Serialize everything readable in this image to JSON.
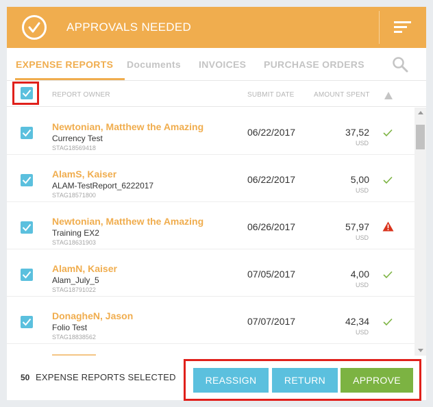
{
  "header": {
    "title": "APPROVALS NEEDED"
  },
  "tabs": [
    {
      "label": "EXPENSE REPORTS",
      "active": true
    },
    {
      "label": "Documents",
      "active": false
    },
    {
      "label": "INVOICES",
      "active": false
    },
    {
      "label": "PURCHASE ORDERS",
      "active": false
    }
  ],
  "columns": {
    "owner": "REPORT OWNER",
    "date": "SUBMIT DATE",
    "amount": "AMOUNT SPENT"
  },
  "rows": [
    {
      "owner": "Newtonian, Matthew the Amazing",
      "report": "Currency Test",
      "code": "STAG18569418",
      "date": "06/22/2017",
      "amount": "37,52",
      "currency": "USD",
      "status": "ok"
    },
    {
      "owner": "AlamS, Kaiser",
      "report": "ALAM-TestReport_6222017",
      "code": "STAG18571800",
      "date": "06/22/2017",
      "amount": "5,00",
      "currency": "USD",
      "status": "ok"
    },
    {
      "owner": "Newtonian, Matthew the Amazing",
      "report": "Training EX2",
      "code": "STAG18631903",
      "date": "06/26/2017",
      "amount": "57,97",
      "currency": "USD",
      "status": "warning"
    },
    {
      "owner": "AlamN, Kaiser",
      "report": "Alam_July_5",
      "code": "STAG18791022",
      "date": "07/05/2017",
      "amount": "4,00",
      "currency": "USD",
      "status": "ok"
    },
    {
      "owner": "DonagheN, Jason",
      "report": "Folio Test",
      "code": "STAG18838562",
      "date": "07/07/2017",
      "amount": "42,34",
      "currency": "USD",
      "status": "ok"
    }
  ],
  "footer": {
    "selected_count": "50",
    "selected_label": "EXPENSE REPORTS SELECTED",
    "reassign": "REASSIGN",
    "return": "RETURN",
    "approve": "APPROVE"
  },
  "colors": {
    "accent": "#f0ad4e",
    "checkbox": "#5bc0de",
    "approve": "#7cb342",
    "ok": "#7cb342",
    "warning": "#d9331c",
    "highlight": "#e0201b"
  },
  "icons": {
    "header": "check-circle-icon",
    "menu": "sort-lines-icon",
    "search": "search-icon",
    "warning": "warning-triangle-icon",
    "ok": "checkmark-icon"
  }
}
